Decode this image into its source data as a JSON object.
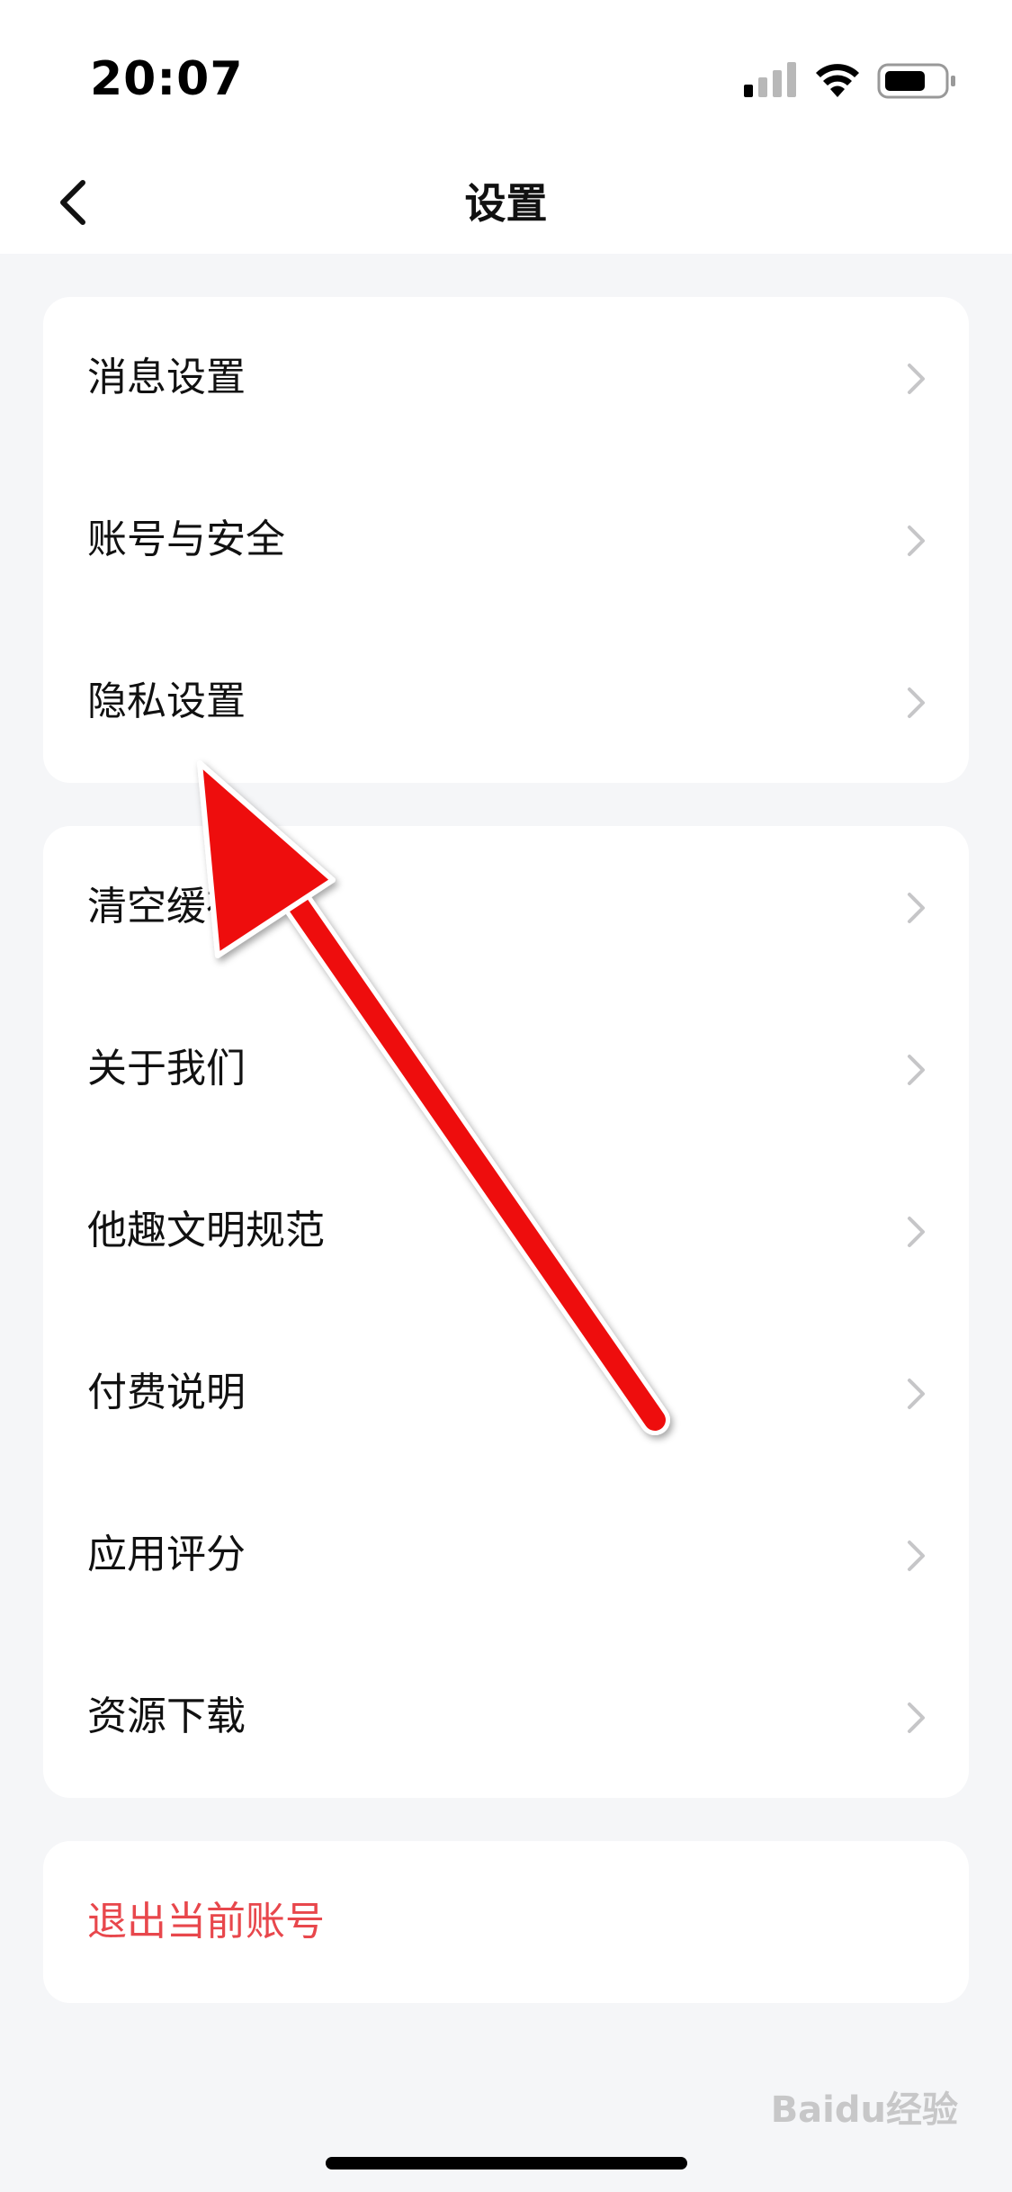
{
  "status_bar": {
    "time": "20:07",
    "signal_icon": "cellular-signal-icon",
    "wifi_icon": "wifi-icon",
    "battery_icon": "battery-icon"
  },
  "nav": {
    "title": "设置",
    "back_icon": "chevron-left-icon"
  },
  "group1": {
    "items": [
      {
        "label": "消息设置"
      },
      {
        "label": "账号与安全"
      },
      {
        "label": "隐私设置"
      }
    ]
  },
  "group2": {
    "items": [
      {
        "label": "清空缓存"
      },
      {
        "label": "关于我们"
      },
      {
        "label": "他趣文明规范"
      },
      {
        "label": "付费说明"
      },
      {
        "label": "应用评分"
      },
      {
        "label": "资源下载"
      }
    ]
  },
  "logout": {
    "label": "退出当前账号"
  },
  "watermark": {
    "text": "Baidu经验"
  },
  "colors": {
    "background": "#f5f6f8",
    "card": "#ffffff",
    "text": "#111111",
    "logout": "#e8474c",
    "chevron": "#c6c6c8",
    "annotation_arrow": "#ee1111"
  }
}
